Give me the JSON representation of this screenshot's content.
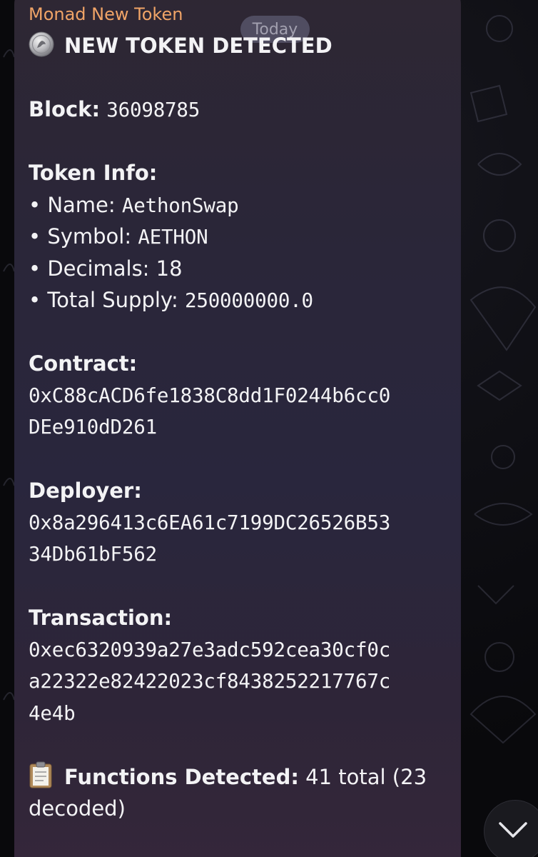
{
  "chat": {
    "sender": "Monad New Token",
    "date_label": "Today"
  },
  "message": {
    "header": "NEW TOKEN DETECTED",
    "header_icon": "coin-emoji-icon",
    "block_label": "Block:",
    "block_value": "36098785",
    "token_info_label": "Token Info:",
    "name_prefix": "• Name: ",
    "name_value": "AethonSwap",
    "symbol_prefix": "• Symbol: ",
    "symbol_value": "AETHON",
    "decimals_text": "• Decimals: 18",
    "supply_prefix": "• Total Supply: ",
    "supply_value": "250000000.0",
    "contract_label": "Contract:",
    "contract_line1": "0xC88cACD6fe1838C8dd1F0244b6cc0",
    "contract_line2": "DEe910dD261",
    "deployer_label": "Deployer:",
    "deployer_line1": "0x8a296413c6EA61c7199DC26526B53",
    "deployer_line2": "34Db61bF562",
    "transaction_label": "Transaction:",
    "tx_line1": "0xec6320939a27e3adc592cea30cf0c",
    "tx_line2": "a22322e82422023cf8438252217767c",
    "tx_line3": "4e4b",
    "functions_icon": "clipboard-emoji-icon",
    "functions_label": "Functions Detected:",
    "functions_value_line1": " 41 total (23",
    "functions_value_line2": "decoded)"
  },
  "ui": {
    "scroll_down_icon": "chevron-down-icon",
    "accent_color": "#f0a467"
  }
}
